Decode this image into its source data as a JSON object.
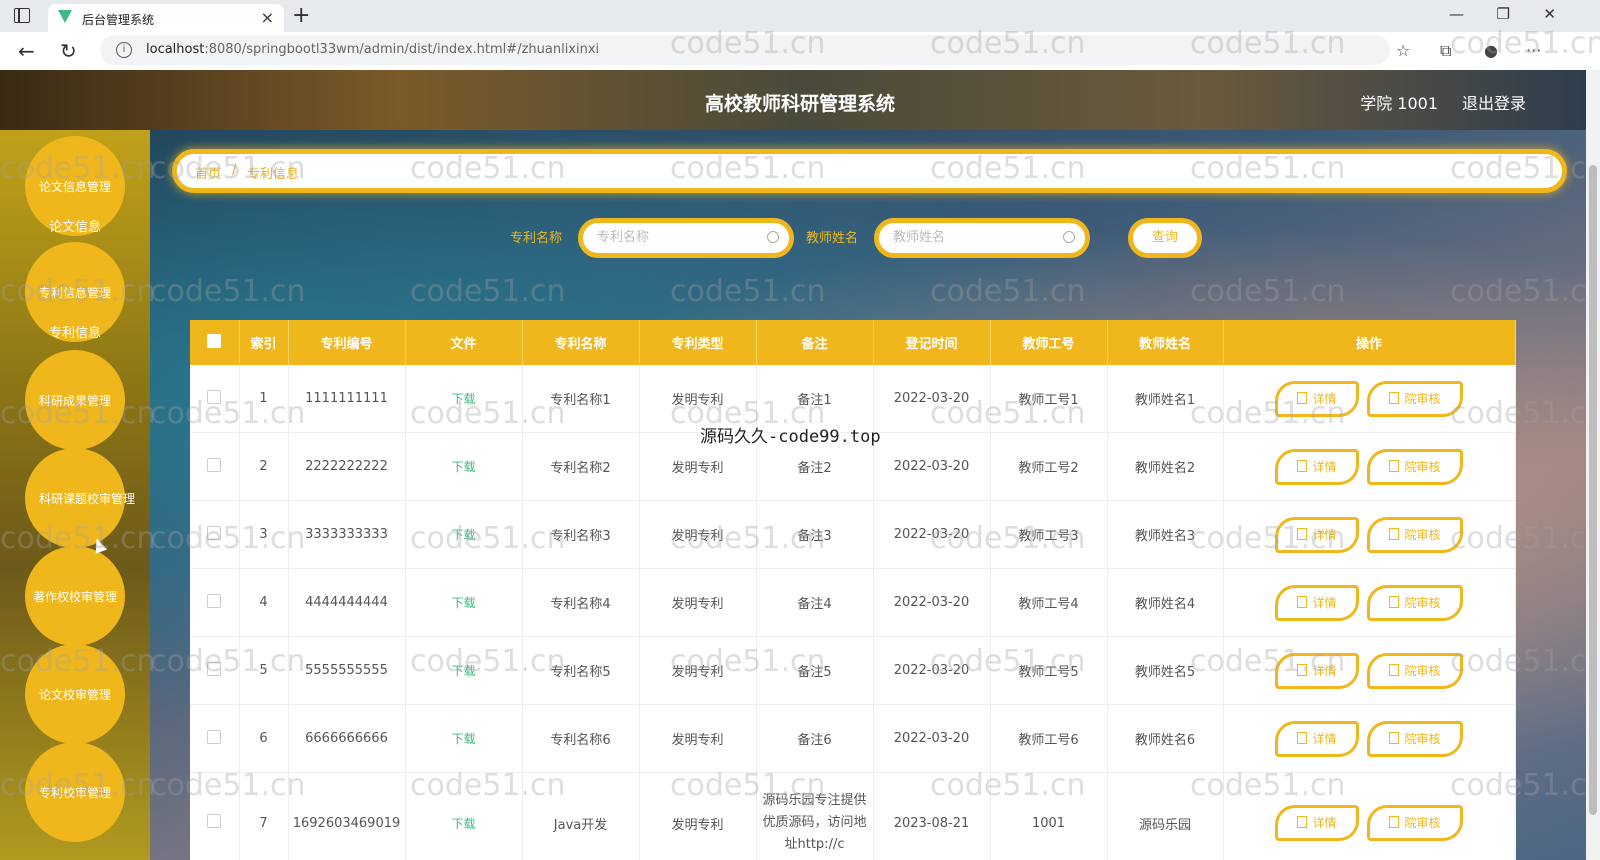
{
  "browser": {
    "tab_title": "后台管理系统",
    "url_host": "localhost",
    "url_rest": ":8080/springbootl33wm/admin/dist/index.html#/zhuanlixinxi"
  },
  "header": {
    "title": "高校教师科研管理系统",
    "user": "学院 1001",
    "logout": "退出登录"
  },
  "sidebar": {
    "items": [
      {
        "label": "论文信息管理",
        "sub": "论文信息"
      },
      {
        "label": "专利信息管理",
        "sub": "专利信息"
      },
      {
        "label": "科研成果管理",
        "sub": ""
      },
      {
        "label": "科研课题校审管理",
        "sub": ""
      },
      {
        "label": "著作权校审管理",
        "sub": ""
      },
      {
        "label": "论文校审管理",
        "sub": ""
      },
      {
        "label": "专利校审管理",
        "sub": ""
      }
    ]
  },
  "breadcrumb": {
    "home": "首页",
    "sep": "/",
    "current": "专利信息"
  },
  "search": {
    "patent_label": "专利名称",
    "patent_placeholder": "专利名称",
    "teacher_label": "教师姓名",
    "teacher_placeholder": "教师姓名",
    "query_button": "查询"
  },
  "table": {
    "headers": [
      "索引",
      "专利编号",
      "文件",
      "专利名称",
      "专利类型",
      "备注",
      "登记时间",
      "教师工号",
      "教师姓名",
      "操作"
    ],
    "rows": [
      {
        "index": "1",
        "number": "1111111111",
        "file": "下载",
        "name": "专利名称1",
        "type": "发明专利",
        "remark": "备注1",
        "date": "2022-03-20",
        "teacher_no": "教师工号1",
        "teacher_name": "教师姓名1"
      },
      {
        "index": "2",
        "number": "2222222222",
        "file": "下载",
        "name": "专利名称2",
        "type": "发明专利",
        "remark": "备注2",
        "date": "2022-03-20",
        "teacher_no": "教师工号2",
        "teacher_name": "教师姓名2"
      },
      {
        "index": "3",
        "number": "3333333333",
        "file": "下载",
        "name": "专利名称3",
        "type": "发明专利",
        "remark": "备注3",
        "date": "2022-03-20",
        "teacher_no": "教师工号3",
        "teacher_name": "教师姓名3"
      },
      {
        "index": "4",
        "number": "4444444444",
        "file": "下载",
        "name": "专利名称4",
        "type": "发明专利",
        "remark": "备注4",
        "date": "2022-03-20",
        "teacher_no": "教师工号4",
        "teacher_name": "教师姓名4"
      },
      {
        "index": "5",
        "number": "5555555555",
        "file": "下载",
        "name": "专利名称5",
        "type": "发明专利",
        "remark": "备注5",
        "date": "2022-03-20",
        "teacher_no": "教师工号5",
        "teacher_name": "教师姓名5"
      },
      {
        "index": "6",
        "number": "6666666666",
        "file": "下载",
        "name": "专利名称6",
        "type": "发明专利",
        "remark": "备注6",
        "date": "2022-03-20",
        "teacher_no": "教师工号6",
        "teacher_name": "教师姓名6"
      },
      {
        "index": "7",
        "number": "1692603469019",
        "file": "下载",
        "name": "Java开发",
        "type": "发明专利",
        "remark": "源码乐园专注提供优质源码，访问地址http://c",
        "date": "2023-08-21",
        "teacher_no": "1001",
        "teacher_name": "源码乐园"
      }
    ],
    "detail_label": "详情",
    "audit_label": "院审核"
  },
  "overlay": {
    "center_watermark": "源码久久-code99.top",
    "repeat_watermark": "code51.cn"
  },
  "colors": {
    "accent": "#f0b71c",
    "link": "#3fb984"
  }
}
